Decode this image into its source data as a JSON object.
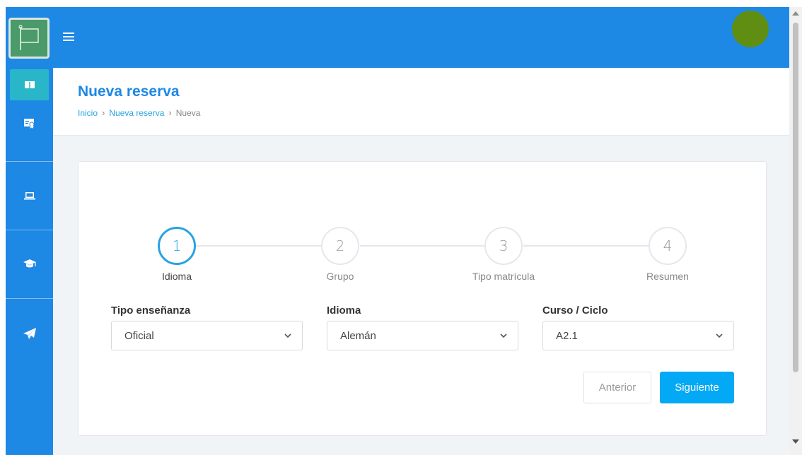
{
  "header": {
    "title": "Nueva reserva",
    "breadcrumb": [
      {
        "label": "Inicio"
      },
      {
        "label": "Nueva reserva"
      },
      {
        "label": "Nueva"
      }
    ]
  },
  "sidebar": {
    "icons": [
      "flag-logo-icon",
      "book-icon",
      "certificate-icon",
      "laptop-icon",
      "graduation-cap-icon",
      "paper-plane-icon"
    ]
  },
  "colors": {
    "primary": "#1e88e5",
    "accent": "#03a9f4",
    "avatar": "#5f8e12"
  },
  "wizard": {
    "steps": [
      {
        "number": "1",
        "label": "Idioma",
        "active": true
      },
      {
        "number": "2",
        "label": "Grupo",
        "active": false
      },
      {
        "number": "3",
        "label": "Tipo matrícula",
        "active": false
      },
      {
        "number": "4",
        "label": "Resumen",
        "active": false
      }
    ]
  },
  "form": {
    "tipo_ensenanza": {
      "label": "Tipo enseñanza",
      "value": "Oficial"
    },
    "idioma": {
      "label": "Idioma",
      "value": "Alemán"
    },
    "curso": {
      "label": "Curso / Ciclo",
      "value": "A2.1"
    }
  },
  "buttons": {
    "prev": "Anterior",
    "next": "Siguiente"
  }
}
